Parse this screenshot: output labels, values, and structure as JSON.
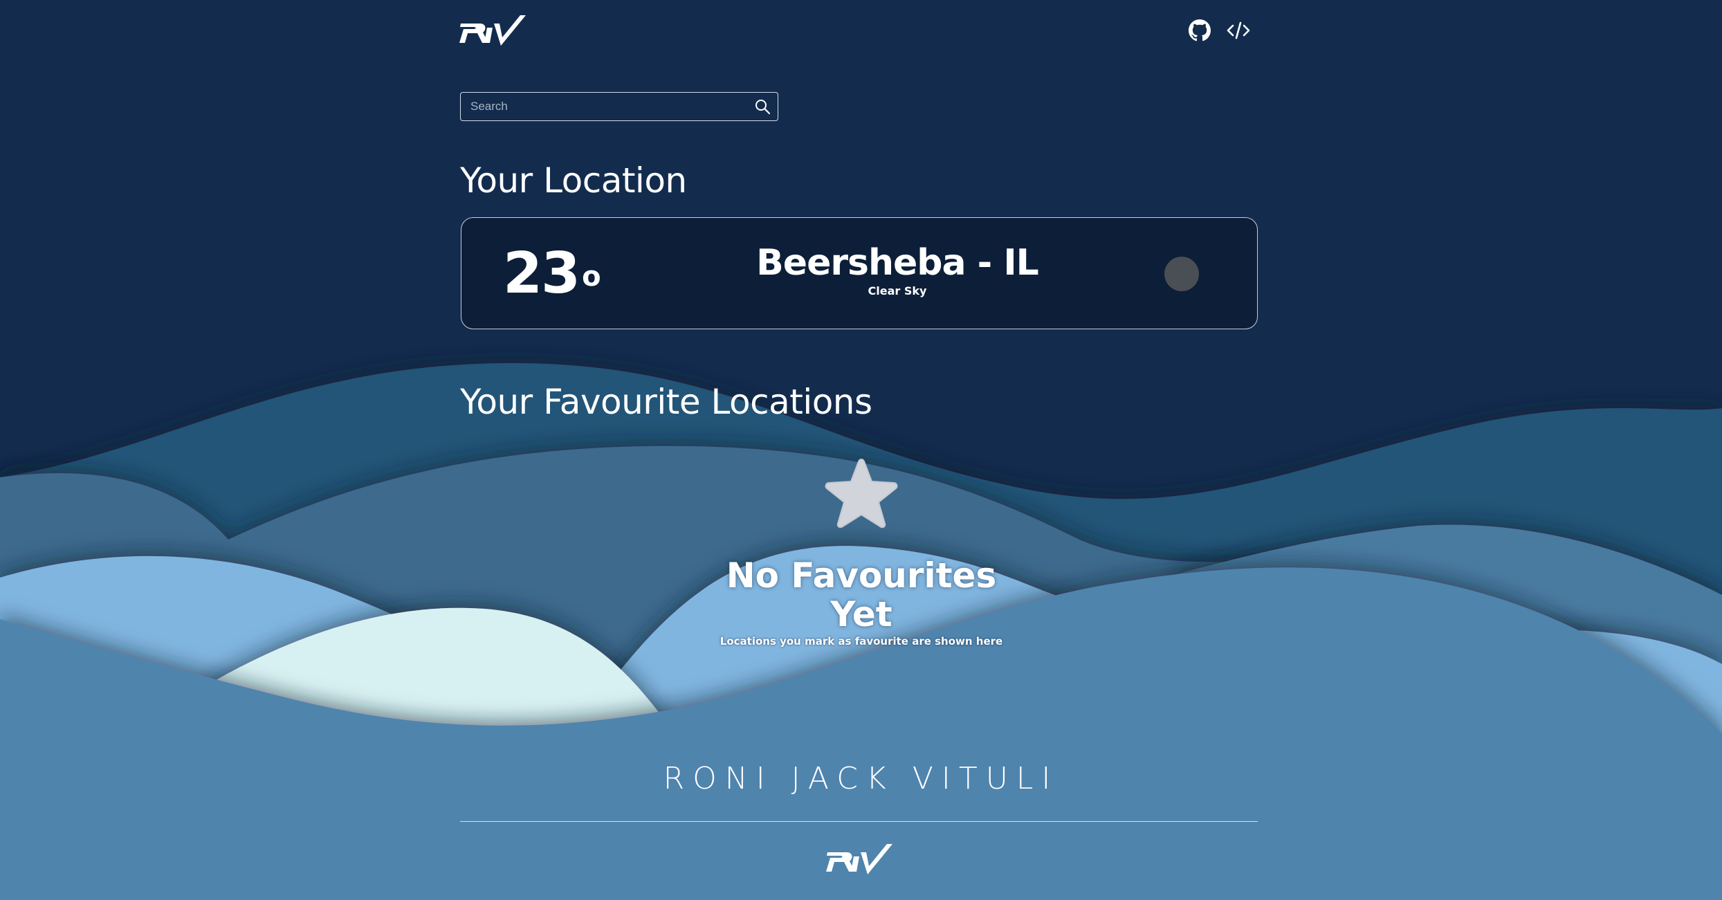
{
  "header": {
    "logo_icon": "rjv-logo-icon",
    "github_icon": "github-icon",
    "code_icon": "code-icon"
  },
  "search": {
    "placeholder": "Search",
    "value": "",
    "icon": "search-icon"
  },
  "your_location": {
    "title": "Your Location",
    "temperature": "23",
    "degree_symbol": "o",
    "city": "Beersheba - IL",
    "condition": "Clear Sky"
  },
  "favourites": {
    "title": "Your Favourite Locations",
    "empty_icon": "star-icon",
    "empty_title": "No Favourites Yet",
    "empty_subtitle": "Locations you mark as favourite are shown here"
  },
  "footer": {
    "name": "RONI JACK VITULI",
    "logo_icon": "rjv-logo-icon"
  },
  "colors": {
    "background": "#132c4e",
    "card": "#0d1e38",
    "wave_dark": "#245578",
    "wave_mid": "#3d6b8d",
    "wave_light": "#80b5df",
    "wave_lightest": "#d7f1f2",
    "wave_front": "#5084ad"
  }
}
